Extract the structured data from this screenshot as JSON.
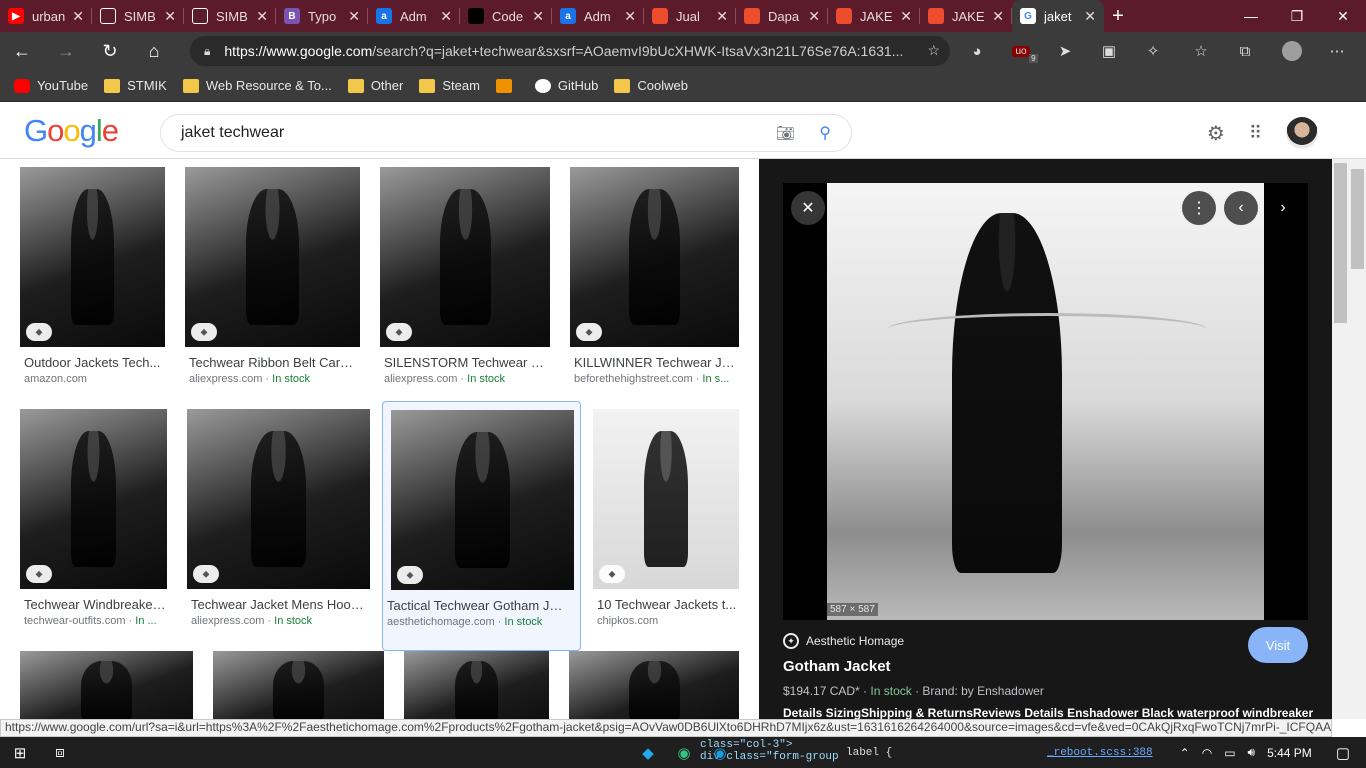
{
  "browser": {
    "tabs": [
      {
        "label": "urban",
        "icon": "youtube-icon",
        "color": "#ff0000"
      },
      {
        "label": "SIMB",
        "icon": "page-icon",
        "color": "#ffffff"
      },
      {
        "label": "SIMB",
        "icon": "page-icon",
        "color": "#ffffff"
      },
      {
        "label": "Typo",
        "icon": "bootstrap-icon",
        "color": "#7952b3"
      },
      {
        "label": "Adm",
        "icon": "a-icon",
        "color": "#1a73e8"
      },
      {
        "label": "Code",
        "icon": "codepen-icon",
        "color": "#000000"
      },
      {
        "label": "Adm",
        "icon": "a-icon",
        "color": "#1a73e8"
      },
      {
        "label": "Jual",
        "icon": "shopee-icon",
        "color": "#ee4d2d"
      },
      {
        "label": "Dapa",
        "icon": "shopee-icon",
        "color": "#ee4d2d"
      },
      {
        "label": "JAKE",
        "icon": "shopee-icon",
        "color": "#ee4d2d"
      },
      {
        "label": "JAKE",
        "icon": "shopee-icon",
        "color": "#ee4d2d"
      },
      {
        "label": "jaket",
        "icon": "google-icon",
        "color": "#ffffff",
        "active": true
      }
    ],
    "url_host": "https://www.google.com",
    "url_rest": "/search?q=jaket+techwear&sxsrf=AOaemvI9bUcXHWK-ItsaVx3n21L76Se76A:1631...",
    "bookmarks": [
      {
        "label": "YouTube",
        "type": "youtube"
      },
      {
        "label": "STMIK",
        "type": "folder"
      },
      {
        "label": "Web Resource & To...",
        "type": "folder"
      },
      {
        "label": "Other",
        "type": "folder"
      },
      {
        "label": "Steam",
        "type": "folder"
      },
      {
        "label": "",
        "type": "aws"
      },
      {
        "label": "GitHub",
        "type": "github"
      },
      {
        "label": "Coolweb",
        "type": "folder"
      }
    ],
    "ext_badge": "9"
  },
  "google": {
    "logo": "Google",
    "query": "jaket techwear"
  },
  "results": [
    {
      "title": "Outdoor Jackets Tech...",
      "source": "amazon.com",
      "stock": ""
    },
    {
      "title": "Techwear Ribbon Belt Cargo ...",
      "source": "aliexpress.com",
      "stock": "In stock"
    },
    {
      "title": "SILENSTORM Techwear Me...",
      "source": "aliexpress.com",
      "stock": "In stock"
    },
    {
      "title": "KILLWINNER Techwear Jac...",
      "source": "beforethehighstreet.com",
      "stock": "In s..."
    },
    {
      "title": "Techwear Windbreaker ...",
      "source": "techwear-outfits.com",
      "stock": "In ..."
    },
    {
      "title": "Techwear Jacket Mens Hoode...",
      "source": "aliexpress.com",
      "stock": "In stock"
    },
    {
      "title": "Tactical Techwear Gotham Ja...",
      "source": "aesthetichomage.com",
      "stock": "In stock"
    },
    {
      "title": "10 Techwear Jackets t...",
      "source": "chipkos.com",
      "stock": ""
    }
  ],
  "panel": {
    "dims": "587 × 587",
    "site": "Aesthetic Homage",
    "title": "Gotham Jacket",
    "price": "$194.17 CAD*",
    "stock": "In stock",
    "brand": "Brand: by Enshadower",
    "desc": "Details SizingShipping & ReturnsReviews Details Enshadower Black waterproof windbreaker",
    "visit": "Visit"
  },
  "status_url": "https://www.google.com/url?sa=i&url=https%3A%2F%2Faesthetichomage.com%2Fproducts%2Fgotham-jacket&psig=AOvVaw0DB6UlXto6DHRhD7MIjx6z&ust=1631616264264000&source=images&cd=vfe&ved=0CAkQjRxqFwoTCNj7mrPi-_ICFQAA...",
  "taskbar": {
    "code_line1": "class=\"col-3\">",
    "code_line2": "div class=\"form-group",
    "code_label": "label {",
    "code_file": "_reboot.scss:388",
    "time": "5:44 PM"
  }
}
